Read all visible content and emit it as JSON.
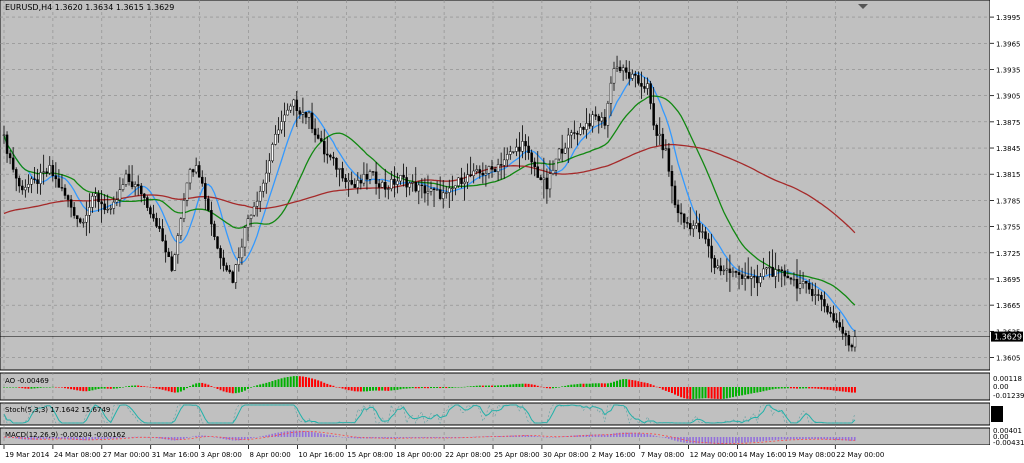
{
  "chart_data": {
    "type": "candlestick",
    "symbol_header": "EURUSD,H4  1.3620 1.3634 1.3615 1.3629",
    "price_scale": [
      1.3995,
      1.3965,
      1.3935,
      1.3905,
      1.3875,
      1.3845,
      1.3815,
      1.3785,
      1.3755,
      1.3725,
      1.3695,
      1.3665,
      1.3635,
      1.3605
    ],
    "price_ylim": [
      1.3593,
      1.401
    ],
    "last_price": 1.3629,
    "last_price_label": "1.3629",
    "x_tick_labels": [
      "19 Mar 2014",
      "24 Mar 08:00",
      "27 Mar 00:00",
      "31 Mar 16:00",
      "3 Apr 08:00",
      "8 Apr 00:00",
      "10 Apr 16:00",
      "15 Apr 08:00",
      "18 Apr 00:00",
      "22 Apr 08:00",
      "25 Apr 08:00",
      "30 Apr 08:00",
      "2 May 16:00",
      "7 May 08:00",
      "12 May 00:00",
      "14 May 16:00",
      "19 May 08:00",
      "22 May 00:00"
    ],
    "price_path": [
      [
        0,
        1.3855
      ],
      [
        5,
        1.38
      ],
      [
        10,
        1.3805
      ],
      [
        15,
        1.382
      ],
      [
        20,
        1.379
      ],
      [
        25,
        1.376
      ],
      [
        30,
        1.379
      ],
      [
        35,
        1.377
      ],
      [
        40,
        1.381
      ],
      [
        45,
        1.3795
      ],
      [
        50,
        1.376
      ],
      [
        55,
        1.3705
      ],
      [
        60,
        1.381
      ],
      [
        63,
        1.383
      ],
      [
        66,
        1.379
      ],
      [
        70,
        1.373
      ],
      [
        75,
        1.3695
      ],
      [
        80,
        1.3765
      ],
      [
        85,
        1.3805
      ],
      [
        90,
        1.387
      ],
      [
        95,
        1.3895
      ],
      [
        100,
        1.388
      ],
      [
        105,
        1.384
      ],
      [
        110,
        1.382
      ],
      [
        115,
        1.38
      ],
      [
        120,
        1.3815
      ],
      [
        125,
        1.38
      ],
      [
        130,
        1.381
      ],
      [
        135,
        1.38
      ],
      [
        140,
        1.3795
      ],
      [
        145,
        1.379
      ],
      [
        150,
        1.381
      ],
      [
        155,
        1.3815
      ],
      [
        160,
        1.382
      ],
      [
        165,
        1.3835
      ],
      [
        170,
        1.385
      ],
      [
        175,
        1.3815
      ],
      [
        178,
        1.38
      ],
      [
        182,
        1.384
      ],
      [
        186,
        1.386
      ],
      [
        190,
        1.387
      ],
      [
        194,
        1.388
      ],
      [
        197,
        1.3875
      ],
      [
        200,
        1.394
      ],
      [
        204,
        1.393
      ],
      [
        208,
        1.392
      ],
      [
        211,
        1.3915
      ],
      [
        213,
        1.387
      ],
      [
        217,
        1.384
      ],
      [
        220,
        1.378
      ],
      [
        223,
        1.376
      ],
      [
        227,
        1.3755
      ],
      [
        230,
        1.374
      ],
      [
        233,
        1.371
      ],
      [
        237,
        1.3705
      ],
      [
        240,
        1.37
      ],
      [
        243,
        1.37
      ],
      [
        247,
        1.369
      ],
      [
        250,
        1.371
      ],
      [
        253,
        1.37
      ],
      [
        257,
        1.37
      ],
      [
        260,
        1.369
      ],
      [
        263,
        1.3685
      ],
      [
        266,
        1.368
      ],
      [
        270,
        1.366
      ],
      [
        274,
        1.364
      ],
      [
        277,
        1.362
      ]
    ],
    "indicator_headers": {
      "ao": "AO -0.00469",
      "stoch": "Stoch(5,3,3) 17.1642 15.6749",
      "macd": "MACD(12,26,9) -0.00204 -0.00162"
    },
    "ao_scale": [
      "0.00118",
      "0.00",
      "-0.01239"
    ],
    "macd_scale": [
      "0.00401",
      "0.00",
      "-0.00431"
    ],
    "colors": {
      "background": "#c0c0c0",
      "grid": "#8a8a8a",
      "candle": "#000000",
      "ma_blue": "#3399ff",
      "ma_green": "#118811",
      "ma_red": "#a52a2a",
      "ao_up": "#00b000",
      "ao_down": "#ff0000",
      "stoch_main": "#20b2aa",
      "macd_hist": "#9370db",
      "macd_signal": "#ff4444"
    }
  }
}
